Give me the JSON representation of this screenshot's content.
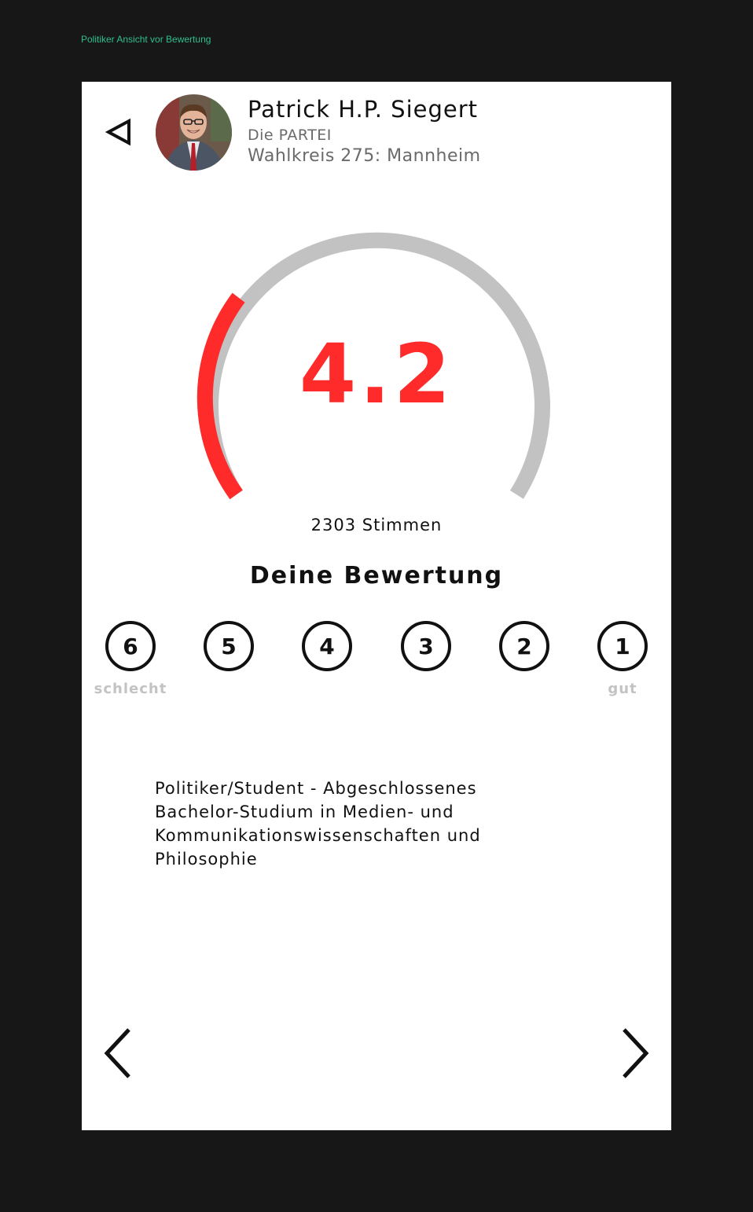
{
  "frame": {
    "label": "Politiker Ansicht vor Bewertung"
  },
  "header": {
    "back_icon": "back-triangle-icon",
    "name": "Patrick H.P. Siegert",
    "party": "Die PARTEI",
    "district": "Wahlkreis 275: Mannheim"
  },
  "score": {
    "value": "4.2",
    "votes": "2303 Stimmen",
    "accent_color": "#ff2a2a",
    "track_color": "#c2c2c2"
  },
  "rating": {
    "heading": "Deine Bewertung",
    "options": [
      "6",
      "5",
      "4",
      "3",
      "2",
      "1"
    ],
    "low_label": "schlecht",
    "high_label": "gut"
  },
  "bio": {
    "text": "Politiker/Student - Abgeschlossenes Bachelor-Studium in Medien- und Kommunikationswissenschaften und Philosophie"
  },
  "navigation": {
    "prev_icon": "chevron-left-icon",
    "next_icon": "chevron-right-icon"
  }
}
